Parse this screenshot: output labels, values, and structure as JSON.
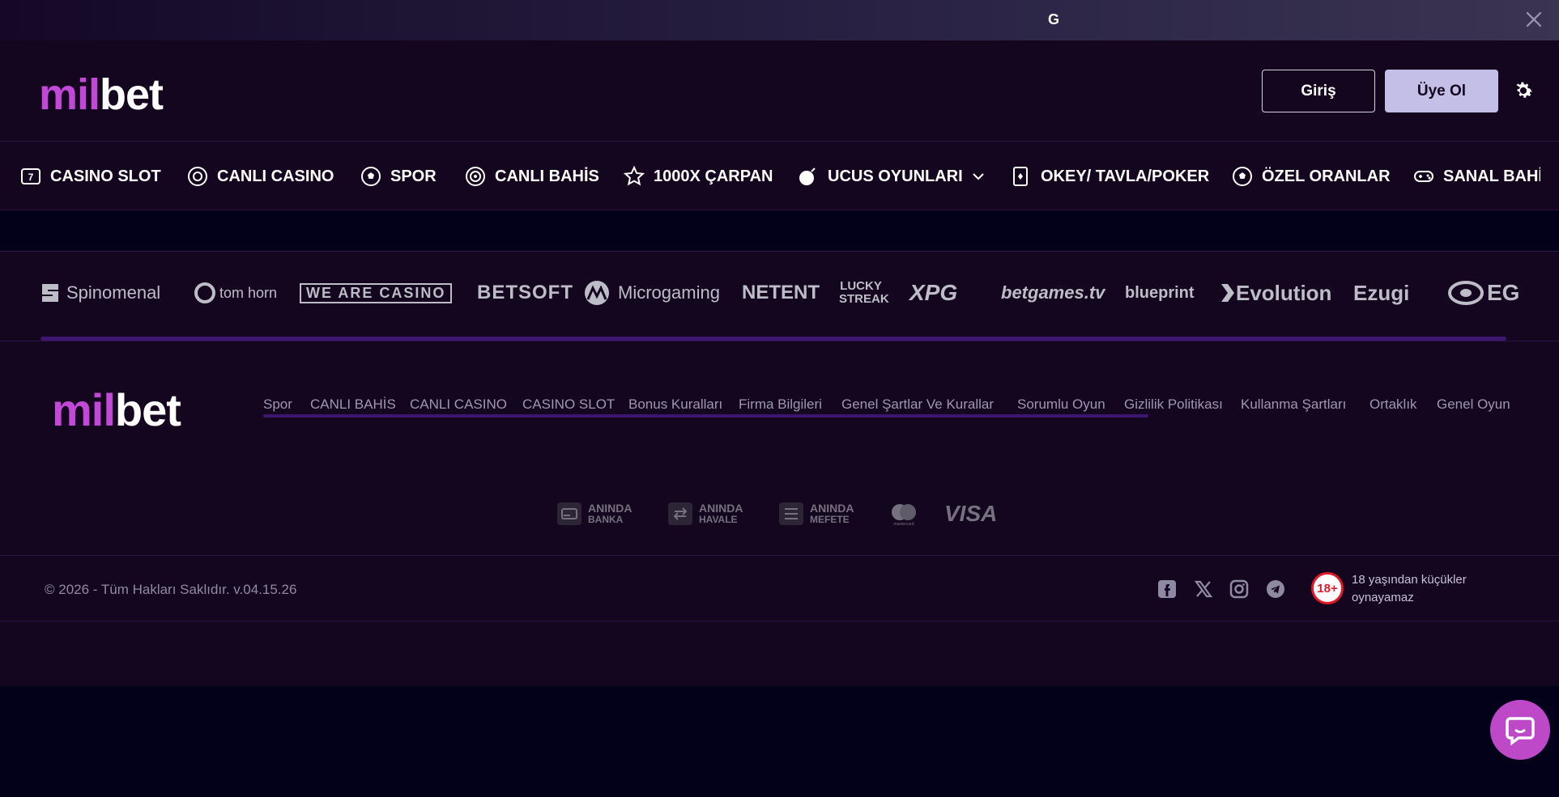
{
  "announcement": {
    "text": "G"
  },
  "header": {
    "logo": {
      "part1": "mil",
      "part2": "bet"
    },
    "login_label": "Giriş",
    "register_label": "Üye Ol"
  },
  "nav": {
    "items": [
      {
        "label": "CASINO SLOT",
        "icon": "slot-icon"
      },
      {
        "label": "CANLI CASINO",
        "icon": "chip-icon"
      },
      {
        "label": "SPOR",
        "icon": "football-icon"
      },
      {
        "label": "CANLI BAHİS",
        "icon": "live-icon"
      },
      {
        "label": "1000X ÇARPAN",
        "icon": "star-icon"
      },
      {
        "label": "UCUS OYUNLARI",
        "icon": "bomb-icon"
      },
      {
        "label": "OKEY/ TAVLA/POKER",
        "icon": "cards-icon"
      },
      {
        "label": "ÖZEL ORANLAR",
        "icon": "football-icon"
      },
      {
        "label": "SANAL BAHİS",
        "icon": "gamepad-icon"
      }
    ]
  },
  "providers": [
    "Spinomenal",
    "tom horn",
    "WE ARE CASINO",
    "BETSOFT",
    "Microgaming",
    "NETENT",
    "LUCKY STREAK",
    "XPG",
    "betgames.tv",
    "blueprint",
    "Evolution",
    "Ezugi",
    "EG"
  ],
  "footer": {
    "logo": {
      "part1": "mil",
      "part2": "bet"
    },
    "links": [
      "Spor",
      "CANLI BAHİS",
      "CANLI CASINO",
      "CASINO SLOT",
      "Bonus Kuralları",
      "Firma Bilgileri",
      "Genel Şartlar Ve Kurallar",
      "Sorumlu Oyun",
      "Gizlilik Politikası",
      "Kullanma Şartları",
      "Ortaklık",
      "Genel Oyun"
    ],
    "payments": [
      {
        "line1": "ANINDA",
        "line2": "BANKA"
      },
      {
        "line1": "ANINDA",
        "line2": "HAVALE"
      },
      {
        "line1": "ANINDA",
        "line2": "MEFETE"
      },
      {
        "line1": "mastercard"
      },
      {
        "line1": "VISA"
      }
    ],
    "copyright": "© 2026 - Tüm Hakları Saklıdır. v.04.15.26",
    "age_badge": "18+",
    "age_text": "18 yaşından küçükler oynayamaz"
  }
}
